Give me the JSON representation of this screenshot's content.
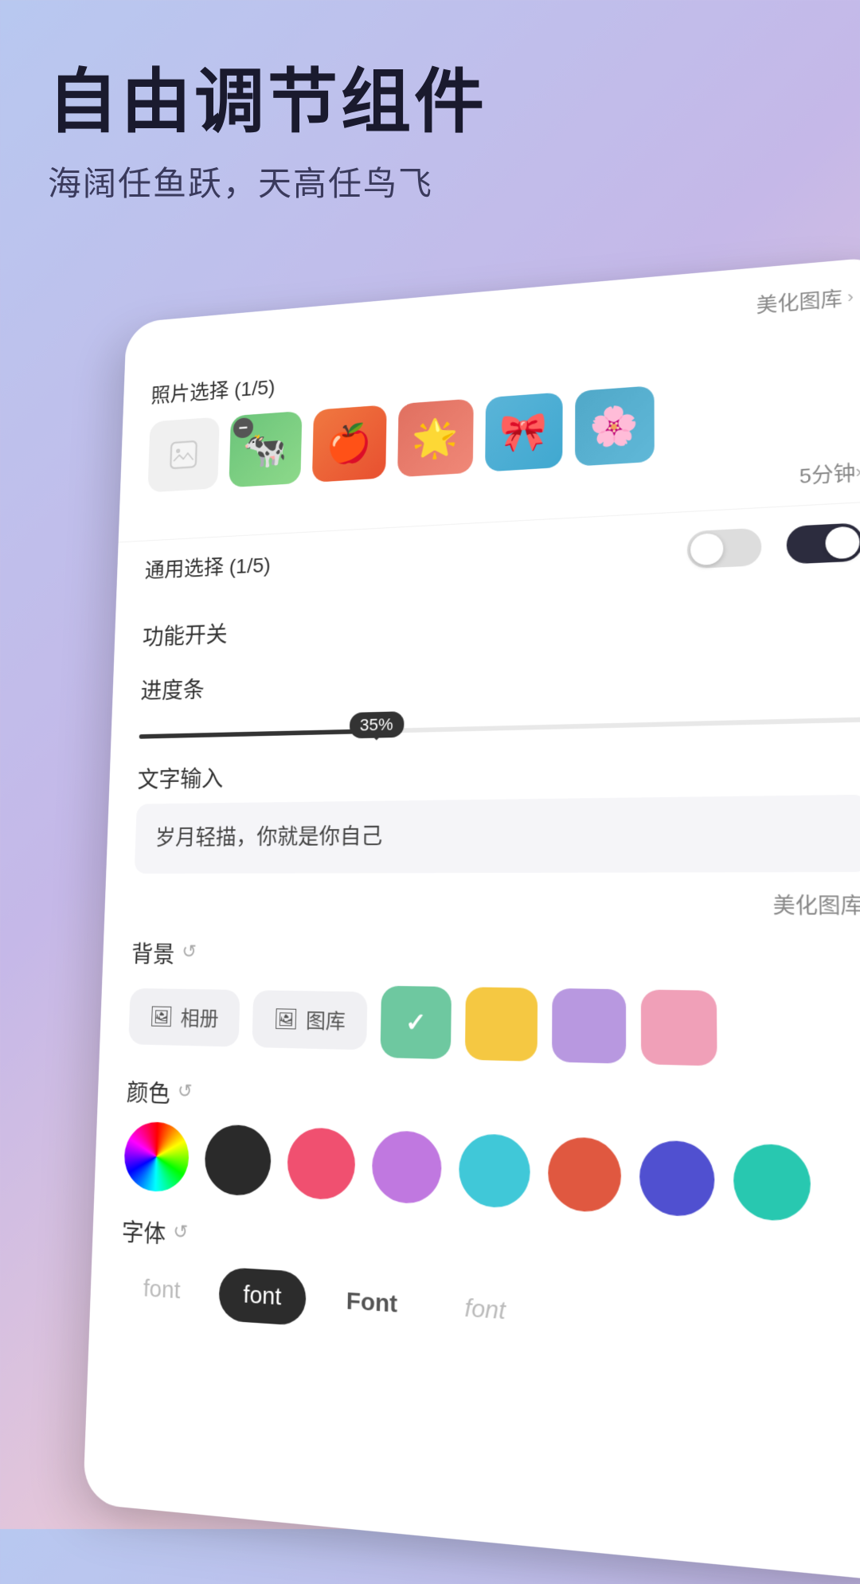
{
  "hero": {
    "title": "自由调节组件",
    "subtitle": "海阔任鱼跃，天高任鸟飞"
  },
  "card": {
    "beauty_link": "美化图库",
    "photo_section": {
      "title": "照片选择 (1/5)",
      "time_label": "5分钟",
      "photos": [
        {
          "id": 1,
          "has_minus": true
        },
        {
          "id": 2
        },
        {
          "id": 3
        },
        {
          "id": 4
        },
        {
          "id": 5
        }
      ]
    },
    "generic_section": {
      "title": "通用选择 (1/5)"
    },
    "feature_toggle": {
      "label": "功能开关"
    },
    "progress": {
      "label": "进度条",
      "value": "35%",
      "percent": 35
    },
    "text_input": {
      "label": "文字输入",
      "value": "岁月轻描，你就是你自己"
    },
    "beauty_link2": "美化图库",
    "background": {
      "label": "背景",
      "album_btn": "相册",
      "gallery_btn": "图库",
      "colors": [
        "green",
        "yellow",
        "purple",
        "pink"
      ]
    },
    "color": {
      "label": "颜色",
      "colors": [
        "wheel",
        "black",
        "pink",
        "purple",
        "cyan",
        "orange",
        "indigo",
        "teal"
      ]
    },
    "font": {
      "label": "字体",
      "options": [
        {
          "label": "font",
          "style": "light-left"
        },
        {
          "label": "font",
          "style": "dark"
        },
        {
          "label": "Font",
          "style": "light-right"
        },
        {
          "label": "font",
          "style": "gray-right"
        }
      ]
    }
  }
}
